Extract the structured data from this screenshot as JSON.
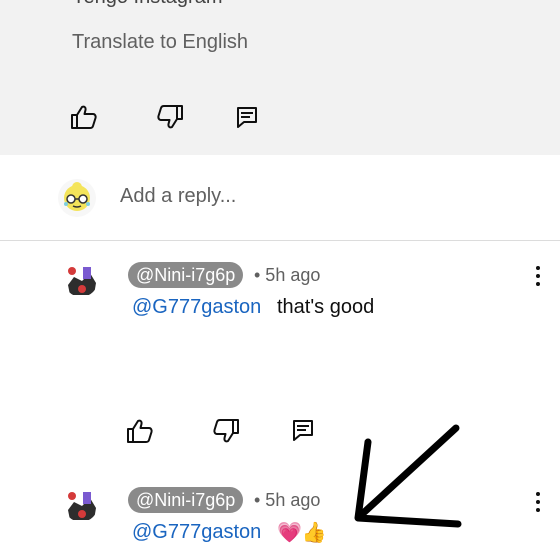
{
  "parent": {
    "text_cut": "Yengo Instagram",
    "translate_label": "Translate to English"
  },
  "reply_box": {
    "placeholder": "Add a reply..."
  },
  "replies": [
    {
      "author": "@Nini-i7g6p",
      "time": "• 5h ago",
      "mention": "@G777gaston",
      "text": "that's good"
    },
    {
      "author": "@Nini-i7g6p",
      "time": "• 5h ago",
      "mention": "@G777gaston",
      "emoji": "💗👍"
    }
  ],
  "icons": [
    "like-icon",
    "dislike-icon",
    "reply-icon",
    "more-icon",
    "arrow-annotation"
  ],
  "colors": {
    "mention": "#1a65c0",
    "top_bg": "#f2f2f2",
    "pill": "#8a8a8a"
  }
}
